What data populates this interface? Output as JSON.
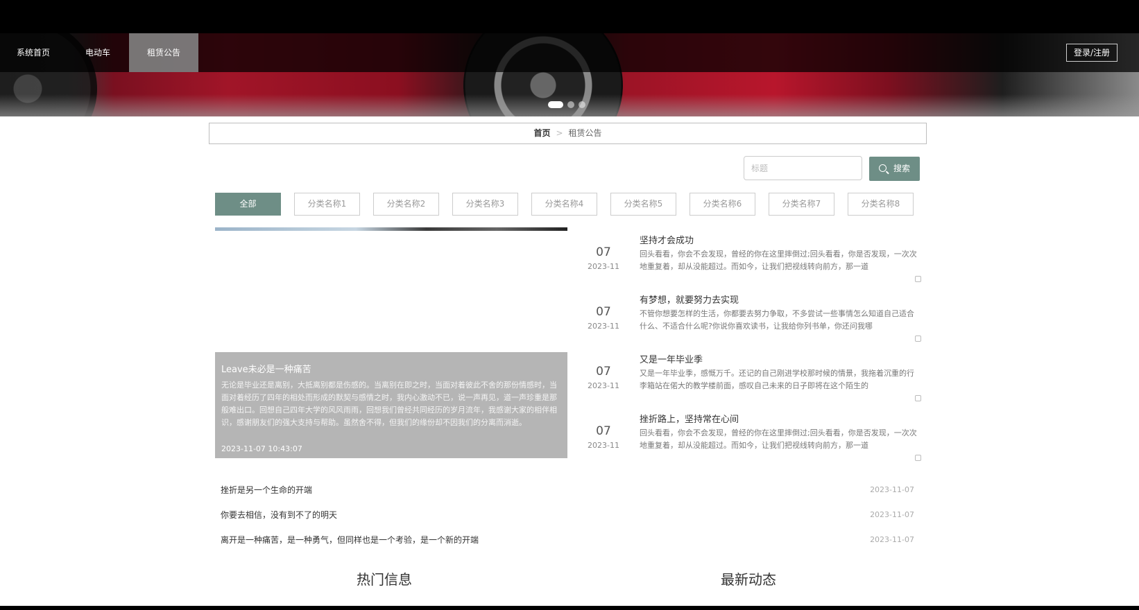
{
  "nav": {
    "items": [
      {
        "label": "系统首页"
      },
      {
        "label": "电动车"
      },
      {
        "label": "租赁公告"
      }
    ],
    "login_label": "登录/注册"
  },
  "breadcrumb": {
    "home": "首页",
    "separator": ">",
    "current": "租赁公告"
  },
  "search": {
    "placeholder": "标题",
    "button_label": "搜索"
  },
  "categories": [
    "全部",
    "分类名称1",
    "分类名称2",
    "分类名称3",
    "分类名称4",
    "分类名称5",
    "分类名称6",
    "分类名称7",
    "分类名称8"
  ],
  "active_category": "全部",
  "feature": {
    "title": "Leave未必是一种痛苦",
    "description": "无论是毕业还是离别，大抵离别都是伤感的。当离别在即之时，当面对着彼此不舍的那份情感时，当面对着经历了四年的相处而形成的默契与感情之时，我内心激动不已，说一声再见，道一声珍重是那般难出口。回想自己四年大学的风风雨雨，回想我们曾经共同经历的岁月流年，我感谢大家的相伴相识，感谢朋友们的强大支持与帮助。虽然舍不得，但我们的缘份却不因我们的分离而消逝。",
    "date": "2023-11-07 10:43:07"
  },
  "list": [
    {
      "title": "挫折是另一个生命的开端",
      "date": "2023-11-07"
    },
    {
      "title": "你要去相信，没有到不了的明天",
      "date": "2023-11-07"
    },
    {
      "title": "离开是一种痛苦，是一种勇气，但同样也是一个考验，是一个新的开端",
      "date": "2023-11-07"
    }
  ],
  "news": [
    {
      "day": "07",
      "month": "2023-11",
      "title": "坚持才会成功",
      "desc": "回头看看，你会不会发现，曾经的你在这里摔倒过;回头看看，你是否发现，一次次地重复着，却从没能超过。而如今，让我们把视线转向前方，那一道"
    },
    {
      "day": "07",
      "month": "2023-11",
      "title": "有梦想，就要努力去实现",
      "desc": "不管你想要怎样的生活，你都要去努力争取，不多尝试一些事情怎么知道自己适合什么、不适合什么呢?你说你喜欢读书，让我给你列书单，你还问我哪"
    },
    {
      "day": "07",
      "month": "2023-11",
      "title": "又是一年毕业季",
      "desc": "又是一年毕业季，感慨万千。还记的自己刚进学校那时候的情景，我拖着沉重的行李箱站在偌大的教学楼前面，感叹自己未来的日子即将在这个陌生的"
    },
    {
      "day": "07",
      "month": "2023-11",
      "title": "挫折路上，坚持常在心间",
      "desc": "回头看看，你会不会发现，曾经的你在这里摔倒过;回头看看，你是否发现，一次次地重复着，却从没能超过。而如今，让我们把视线转向前方，那一道"
    }
  ],
  "sections": {
    "hot": "热门信息",
    "latest": "最新动态"
  }
}
